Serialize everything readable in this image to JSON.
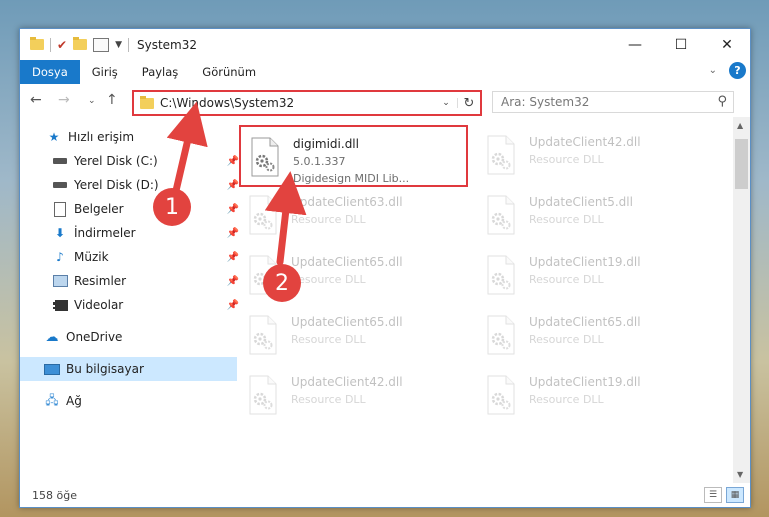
{
  "window": {
    "title": "System32"
  },
  "controls": {
    "minimize": "—",
    "maximize": "☐",
    "close": "✕"
  },
  "ribbon": {
    "tabs": [
      "Dosya",
      "Giriş",
      "Paylaş",
      "Görünüm"
    ],
    "active_tab": "Dosya",
    "help": "?"
  },
  "address": {
    "path": "C:\\Windows\\System32"
  },
  "search": {
    "placeholder": "Ara: System32"
  },
  "sidebar": {
    "items": [
      {
        "label": "Hızlı erişim",
        "icon": "star-icon"
      },
      {
        "label": "Yerel Disk (C:)",
        "icon": "drive-icon",
        "pinned": true
      },
      {
        "label": "Yerel Disk (D:)",
        "icon": "drive-icon",
        "pinned": true
      },
      {
        "label": "Belgeler",
        "icon": "documents-icon",
        "pinned": true
      },
      {
        "label": "İndirmeler",
        "icon": "download-icon",
        "pinned": true
      },
      {
        "label": "Müzik",
        "icon": "music-icon",
        "pinned": true
      },
      {
        "label": "Resimler",
        "icon": "pictures-icon",
        "pinned": true
      },
      {
        "label": "Videolar",
        "icon": "videos-icon",
        "pinned": true
      },
      {
        "label": "OneDrive",
        "icon": "cloud-icon"
      },
      {
        "label": "Bu bilgisayar",
        "icon": "computer-icon",
        "selected": true
      },
      {
        "label": "Ağ",
        "icon": "network-icon"
      }
    ]
  },
  "files": [
    {
      "name": "digimidi.dll",
      "line2": "5.0.1.337",
      "line3": "Digidesign MIDI Lib...",
      "highlighted": true
    },
    {
      "name": "UpdateClient42.dll",
      "line2": "Resource DLL"
    },
    {
      "name": "UpdateClient63.dll",
      "line2": "Resource DLL"
    },
    {
      "name": "UpdateClient5.dll",
      "line2": "Resource DLL"
    },
    {
      "name": "UpdateClient65.dll",
      "line2": "Resource DLL"
    },
    {
      "name": "UpdateClient19.dll",
      "line2": "Resource DLL"
    },
    {
      "name": "UpdateClient65.dll",
      "line2": "Resource DLL"
    },
    {
      "name": "UpdateClient65.dll",
      "line2": "Resource DLL"
    },
    {
      "name": "UpdateClient42.dll",
      "line2": "Resource DLL"
    },
    {
      "name": "UpdateClient19.dll",
      "line2": "Resource DLL"
    }
  ],
  "status": {
    "count": "158 öğe"
  },
  "annotations": {
    "marker1": "1",
    "marker2": "2",
    "color": "#e2433f"
  }
}
